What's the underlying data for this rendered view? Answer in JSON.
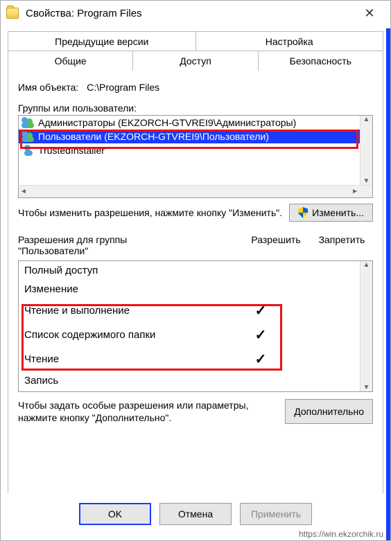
{
  "window": {
    "title": "Свойства: Program Files"
  },
  "tabs": {
    "row1": [
      "Предыдущие версии",
      "Настройка"
    ],
    "row2": [
      "Общие",
      "Доступ",
      "Безопасность"
    ],
    "active": "Безопасность"
  },
  "object": {
    "label": "Имя объекта:",
    "value": "C:\\Program Files"
  },
  "groups": {
    "label": "Группы или пользователи:",
    "items": [
      {
        "text": "Администраторы (EKZORCH-GTVREI9\\Администраторы)",
        "icon": "group",
        "selected": false
      },
      {
        "text": "Пользователи (EKZORCH-GTVREI9\\Пользователи)",
        "icon": "group",
        "selected": true
      },
      {
        "text": "TrustedInstaller",
        "icon": "single",
        "selected": false
      }
    ]
  },
  "edit": {
    "hint": "Чтобы изменить разрешения, нажмите кнопку \"Изменить\".",
    "button": "Изменить..."
  },
  "permissions": {
    "label_prefix": "Разрешения для группы",
    "label_group": "\"Пользователи\"",
    "col_allow": "Разрешить",
    "col_deny": "Запретить",
    "rows": [
      {
        "name": "Полный доступ",
        "allow": false,
        "deny": false
      },
      {
        "name": "Изменение",
        "allow": false,
        "deny": false
      },
      {
        "name": "Чтение и выполнение",
        "allow": true,
        "deny": false
      },
      {
        "name": "Список содержимого папки",
        "allow": true,
        "deny": false
      },
      {
        "name": "Чтение",
        "allow": true,
        "deny": false
      },
      {
        "name": "Запись",
        "allow": false,
        "deny": false
      }
    ]
  },
  "advanced": {
    "hint": "Чтобы задать особые разрешения или параметры, нажмите кнопку \"Дополнительно\".",
    "button": "Дополнительно"
  },
  "footer": {
    "ok": "OK",
    "cancel": "Отмена",
    "apply": "Применить"
  },
  "watermark": "https://win.ekzorchik.ru"
}
